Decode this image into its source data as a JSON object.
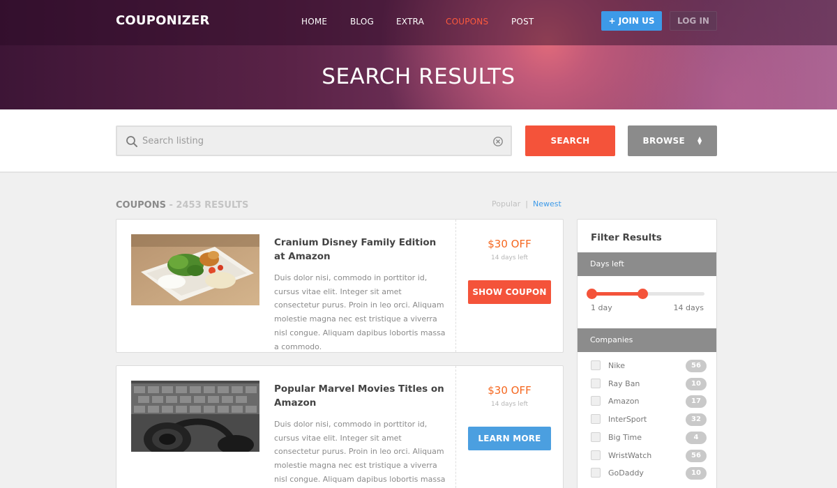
{
  "header": {
    "logo": "COUPONIZER",
    "nav": [
      {
        "label": "HOME",
        "active": false
      },
      {
        "label": "BLOG",
        "active": false
      },
      {
        "label": "EXTRA",
        "active": false
      },
      {
        "label": "COUPONS",
        "active": true
      },
      {
        "label": "POST",
        "active": false
      }
    ],
    "join_label": "+ JOIN US",
    "login_label": "LOG IN"
  },
  "hero": {
    "title": "SEARCH RESULTS"
  },
  "search": {
    "placeholder": "Search listing",
    "value": "",
    "search_label": "SEARCH",
    "browse_label": "BROWSE"
  },
  "results": {
    "category": "COUPONS",
    "count_text": " - 2453 RESULTS",
    "sort": {
      "popular": "Popular",
      "separator": "|",
      "newest": "Newest",
      "active": "Newest"
    }
  },
  "coupons": [
    {
      "title": "Cranium Disney Family Edition at Amazon",
      "description": "Duis dolor nisi, commodo in porttitor id, cursus vitae elit. Integer sit amet consectetur purus. Proin in leo orci. Aliquam molestie magna nec est tristique a viverra nisl congue. Aliquam dapibus lobortis massa a commodo.",
      "discount": "$30 OFF",
      "days_left": "14 days left",
      "button_label": "SHOW COUPON",
      "image": "food-photo"
    },
    {
      "title": "Popular Marvel Movies Titles on Amazon",
      "description": "Duis dolor nisi, commodo in porttitor id, cursus vitae elit. Integer sit amet consectetur purus. Proin in leo orci. Aliquam molestie magna nec est tristique a viverra nisl congue. Aliquam dapibus lobortis massa a commodo.",
      "discount": "$30 OFF",
      "days_left": "14 days left",
      "button_label": "LEARN MORE",
      "image": "headphones-keyboard-photo"
    }
  ],
  "filter": {
    "title": "Filter Results",
    "days_section": "Days left",
    "days_min_label": "1 day",
    "days_max_label": "14 days",
    "range_start": 0.0,
    "range_end": 0.45,
    "companies_section": "Companies",
    "companies": [
      {
        "name": "Nike",
        "count": "56"
      },
      {
        "name": "Ray Ban",
        "count": "10"
      },
      {
        "name": "Amazon",
        "count": "17"
      },
      {
        "name": "InterSport",
        "count": "32"
      },
      {
        "name": "Big Time",
        "count": "4"
      },
      {
        "name": "WristWatch",
        "count": "56"
      },
      {
        "name": "GoDaddy",
        "count": "10"
      }
    ]
  },
  "colors": {
    "accent_orange": "#f4533a",
    "accent_blue": "#3d9ae8",
    "discount": "#f5671f"
  }
}
